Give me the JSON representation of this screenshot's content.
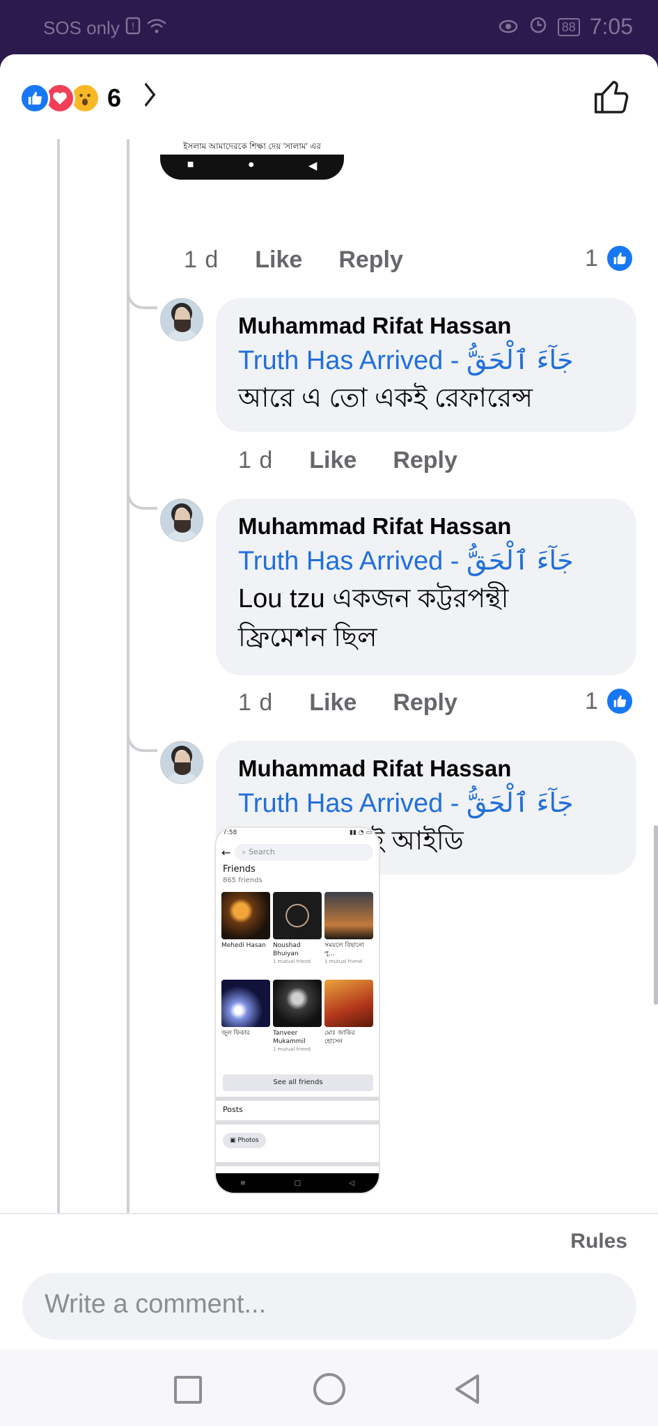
{
  "status_bar": {
    "carrier": "SOS only",
    "battery": "88",
    "time": "7:05"
  },
  "header": {
    "reaction_count": "6",
    "reaction_types": [
      "like",
      "love",
      "wow"
    ]
  },
  "top_comment": {
    "embedded_caption": "ইসলাম আমাদেরকে শিক্ষা দেয় 'সালাম' এর",
    "time": "1 d",
    "like_label": "Like",
    "reply_label": "Reply",
    "like_count": "1"
  },
  "replies": [
    {
      "author": "Muhammad Rifat Hassan",
      "tag": "Truth Has Arrived - جَآءَ ٱلْحَقُّ",
      "text": "আরে এ তো একই রেফারেন্স",
      "time": "1 d",
      "like_label": "Like",
      "reply_label": "Reply",
      "like_count": ""
    },
    {
      "author": "Muhammad Rifat Hassan",
      "tag": "Truth Has Arrived - جَآءَ ٱلْحَقُّ",
      "text": "Lou tzu একজন কট্টরপন্থী ফ্রিমেশন ছিল",
      "time": "1 d",
      "like_label": "Like",
      "reply_label": "Reply",
      "like_count": "1"
    },
    {
      "author": "Muhammad Rifat Hassan",
      "tag": "Truth Has Arrived - جَآءَ ٱلْحَقُّ",
      "text": "তার ফ্রেন্ড এই আইডি",
      "time": "",
      "like_label": "",
      "reply_label": "",
      "like_count": ""
    }
  ],
  "embedded_friends": {
    "time": "7:58",
    "search_placeholder": "Search",
    "title": "Friends",
    "count": "865 friends",
    "friends": [
      {
        "name": "Mehedi Hasan",
        "mutual": ""
      },
      {
        "name": "Noushad Bhuiyan",
        "mutual": "1 mutual friend"
      },
      {
        "name": "সময়লে বিছানো পু...",
        "mutual": "1 mutual friend"
      },
      {
        "name": "জুল ফিকার",
        "mutual": ""
      },
      {
        "name": "Tanveer Mukammil",
        "mutual": "1 mutual friend"
      },
      {
        "name": "মোঃ জাকির হোসেন",
        "mutual": ""
      }
    ],
    "see_all": "See all friends",
    "posts": "Posts",
    "photos": "Photos"
  },
  "footer": {
    "rules": "Rules",
    "comment_placeholder": "Write a comment..."
  }
}
